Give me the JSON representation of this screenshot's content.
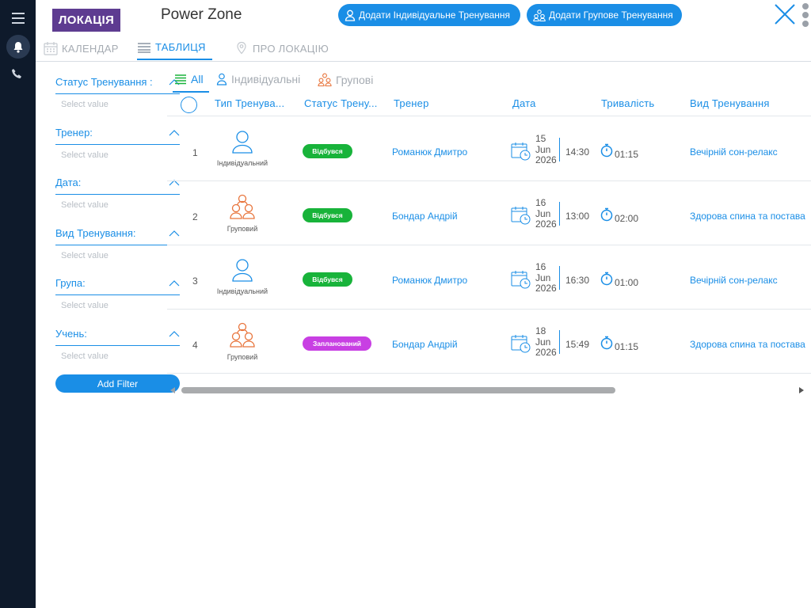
{
  "header": {
    "badge": "ЛОКАЦІЯ",
    "title": "Power Zone",
    "add_individual": "Додати Індивідуальне Тренування",
    "add_group": "Додати Групове Тренування",
    "accent": "#1a8ee6",
    "badge_color": "#5e3c91"
  },
  "tabs": [
    {
      "label": "КАЛЕНДАР",
      "icon": "calendar-icon"
    },
    {
      "label": "ТАБЛИЦЯ",
      "icon": "list-icon"
    },
    {
      "label": "ПРО ЛОКАЦІЮ",
      "icon": "location-pin-icon"
    }
  ],
  "filters": [
    {
      "label": "Статус Тренування :",
      "placeholder": "Select value"
    },
    {
      "label": "Тренер:",
      "placeholder": "Select value"
    },
    {
      "label": "Дата:",
      "placeholder": "Select value"
    },
    {
      "label": "Вид Тренування:",
      "placeholder": "Select value"
    },
    {
      "label": "Група:",
      "placeholder": "Select value"
    },
    {
      "label": "Учень:",
      "placeholder": "Select value"
    }
  ],
  "add_filter": "Add Filter",
  "type_toggles": {
    "all": "All",
    "individual": "Індивідуальні",
    "group": "Групові"
  },
  "columns": {
    "type": "Тип Тренува...",
    "status": "Статус Трену...",
    "trainer": "Тренер",
    "date": "Дата",
    "duration": "Тривалість",
    "kind": "Вид Тренування"
  },
  "rows": [
    {
      "num": "1",
      "type": "Індивідуальний",
      "status": "Відбувся",
      "trainer": "Романюк Дмитро",
      "day": "15",
      "month": "Jun",
      "year": "2026",
      "time": "14:30",
      "duration": "01:15",
      "kind": "Вечірній сон-релакс"
    },
    {
      "num": "2",
      "type": "Груповий",
      "status": "Відбувся",
      "trainer": "Бондар Андрій",
      "day": "16",
      "month": "Jun",
      "year": "2026",
      "time": "13:00",
      "duration": "02:00",
      "kind": "Здорова спина та постава"
    },
    {
      "num": "3",
      "type": "Індивідуальний",
      "status": "Відбувся",
      "trainer": "Романюк Дмитро",
      "day": "16",
      "month": "Jun",
      "year": "2026",
      "time": "16:30",
      "duration": "01:00",
      "kind": "Вечірній сон-релакс"
    },
    {
      "num": "4",
      "type": "Груповий",
      "status": "Запланований",
      "trainer": "Бондар Андрій",
      "day": "18",
      "month": "Jun",
      "year": "2026",
      "time": "15:49",
      "duration": "01:15",
      "kind": "Здорова спина та постава"
    }
  ],
  "status_colors": {
    "done": "#18b33a",
    "planned": "#c83fe3"
  }
}
